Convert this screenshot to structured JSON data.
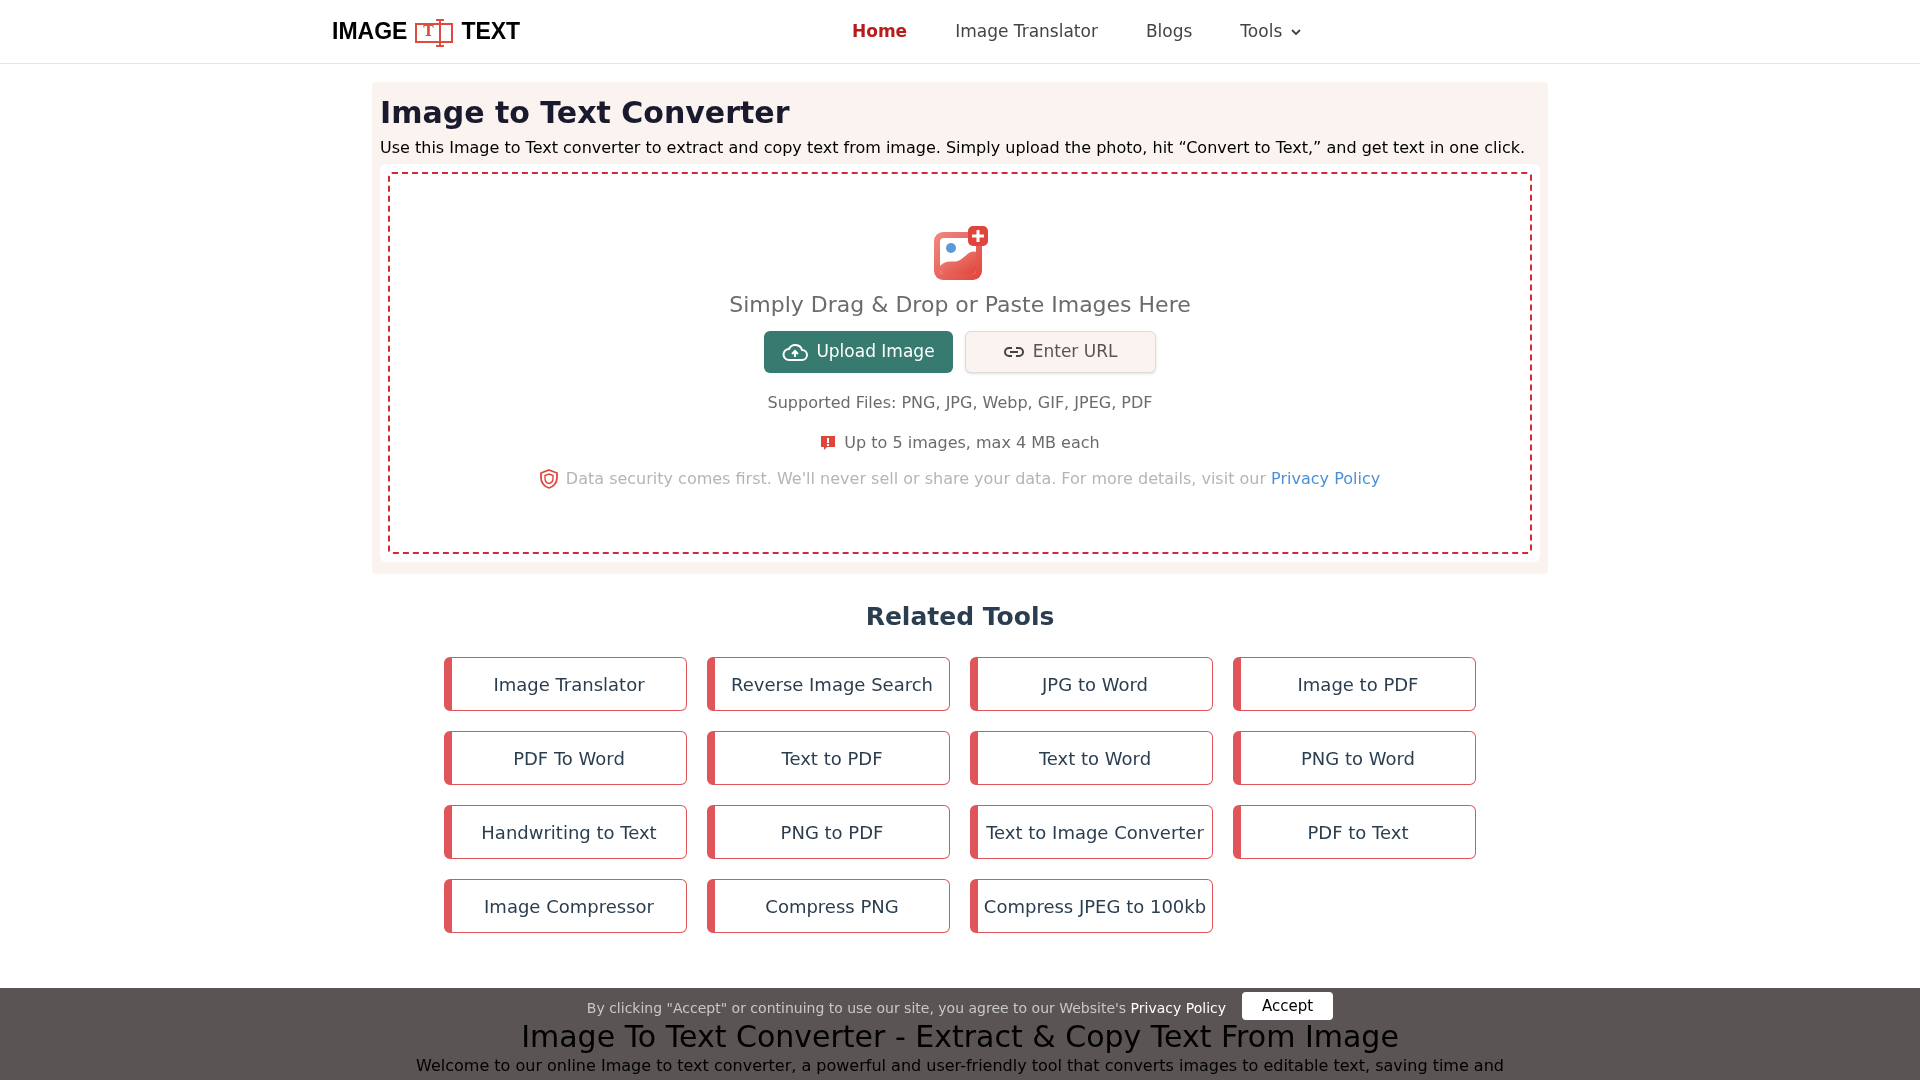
{
  "header": {
    "logo": {
      "left": "IMAGE",
      "mark": "T",
      "right": "TEXT"
    },
    "nav": [
      {
        "label": "Home",
        "selected": true,
        "dropdown": false
      },
      {
        "label": "Image Translator",
        "selected": false,
        "dropdown": false
      },
      {
        "label": "Blogs",
        "selected": false,
        "dropdown": false
      },
      {
        "label": "Tools",
        "selected": false,
        "dropdown": true
      }
    ]
  },
  "converter": {
    "title": "Image to Text Converter",
    "subtitle": "Use this Image to Text converter to extract and copy text from image. Simply upload the photo, hit “Convert to Text,” and get text in one click.",
    "dropzone": {
      "prompt": "Simply Drag & Drop or Paste Images Here",
      "upload_button": "Upload Image",
      "url_button": "Enter URL",
      "supported": "Supported Files: PNG, JPG, Webp, GIF, JPEG, PDF",
      "limit": "Up to 5 images, max 4 MB each",
      "security": "Data security comes first. We'll never sell or share your data. For more details, visit our",
      "security_link": "Privacy Policy"
    }
  },
  "related_tools": {
    "title": "Related Tools",
    "items": [
      "Image Translator",
      "Reverse Image Search",
      "JPG to Word",
      "Image to PDF",
      "PDF To Word",
      "Text to PDF",
      "Text to Word",
      "PNG to Word",
      "Handwriting to Text",
      "PNG to PDF",
      "Text to Image Converter",
      "PDF to Text",
      "Image Compressor",
      "Compress PNG",
      "Compress JPEG to 100kb"
    ]
  },
  "article": {
    "title": "Image To Text Converter - Extract & Copy Text From Image",
    "intro": "Welcome to our online Image to text converter, a powerful and user-friendly tool that converts images to editable text, saving time and"
  },
  "cookie_banner": {
    "text": "By clicking \"Accept\" or continuing to use our site, you agree to our Website's",
    "link": "Privacy Policy",
    "button": "Accept"
  }
}
